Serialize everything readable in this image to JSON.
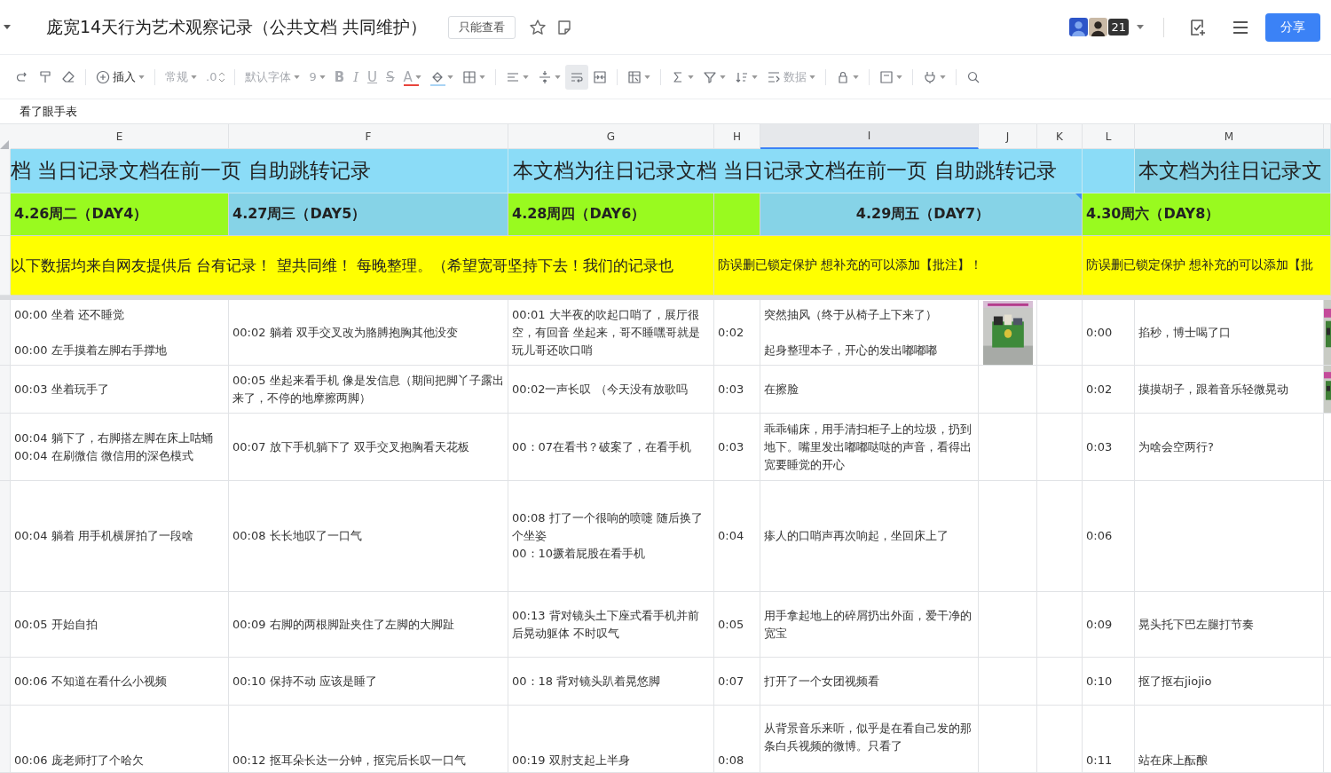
{
  "document": {
    "title": "庞宽14天行为艺术观察记录（公共文档 共同维护）",
    "permission_badge": "只能查看",
    "avatar_count": "21",
    "share_button": "分享"
  },
  "toolbar": {
    "groups": [
      [
        {
          "kind": "redo",
          "active": false
        },
        {
          "kind": "painter",
          "active": false
        },
        {
          "kind": "eraser",
          "active": false
        }
      ],
      [
        {
          "kind": "insert",
          "label": "插入",
          "caret": true,
          "active": false
        }
      ],
      [
        {
          "kind": "format",
          "label": "常规",
          "caret": true,
          "active": false
        },
        {
          "kind": "decimal",
          "label": ".0",
          "active": false
        }
      ],
      [
        {
          "kind": "font",
          "label": "默认字体",
          "caret": true,
          "active": false
        },
        {
          "kind": "size",
          "label": "9",
          "caret": true,
          "active": false
        },
        {
          "kind": "bold",
          "label": "B",
          "active": false
        },
        {
          "kind": "italic",
          "label": "I",
          "active": false
        },
        {
          "kind": "underline",
          "label": "U",
          "active": false
        },
        {
          "kind": "strike",
          "label": "S",
          "active": false
        },
        {
          "kind": "fontcolor",
          "label": "A",
          "caret": true,
          "color": "#e8453c",
          "active": false
        },
        {
          "kind": "fill",
          "caret": true,
          "color": "#a9d4f5",
          "active": false
        },
        {
          "kind": "border",
          "caret": true,
          "active": false
        }
      ],
      [
        {
          "kind": "align",
          "caret": true,
          "active": false
        },
        {
          "kind": "valign",
          "caret": true,
          "active": false
        },
        {
          "kind": "wrap",
          "active": true
        },
        {
          "kind": "merge",
          "active": false
        }
      ],
      [
        {
          "kind": "condfmt",
          "caret": true,
          "active": false
        }
      ],
      [
        {
          "kind": "sum",
          "caret": true,
          "active": false
        },
        {
          "kind": "filter",
          "caret": true,
          "active": false
        },
        {
          "kind": "sort",
          "caret": true,
          "active": false
        },
        {
          "kind": "data",
          "label": "数据",
          "caret": true,
          "active": false
        }
      ],
      [
        {
          "kind": "lock",
          "caret": true,
          "active": false
        }
      ],
      [
        {
          "kind": "frame",
          "caret": true,
          "active": false
        }
      ],
      [
        {
          "kind": "plug",
          "caret": true,
          "active": false
        }
      ],
      [
        {
          "kind": "search",
          "active": false
        }
      ]
    ]
  },
  "formula_bar": {
    "value": "看了眼手表"
  },
  "columns": [
    {
      "label": "E",
      "selected": false
    },
    {
      "label": "F",
      "selected": false
    },
    {
      "label": "G",
      "selected": false
    },
    {
      "label": "H",
      "selected": false
    },
    {
      "label": "I",
      "selected": true
    },
    {
      "label": "J",
      "selected": false
    },
    {
      "label": "K",
      "selected": false
    },
    {
      "label": "L",
      "selected": false
    },
    {
      "label": "M",
      "selected": false
    }
  ],
  "banner_row": [
    "档 当日记录文档在前一页 自助跳转记录",
    "本文档为往日记录文档 当日记录文档在前一页 自助跳转记录",
    "本文档为往日记录文"
  ],
  "day_row": [
    {
      "text": "4.26周二（DAY4）",
      "color": "#99fa1f",
      "has_comment": false
    },
    {
      "text": "4.27周三（DAY5）",
      "color": "#86d3e7",
      "has_comment": false
    },
    {
      "text": "4.28周四（DAY6）",
      "color": "#99fa1f",
      "has_comment": false
    },
    {
      "color": "#99fa1f",
      "has_comment": false
    },
    {
      "text": "4.29周五（DAY7）",
      "color": "#86d3e7",
      "has_comment": true
    },
    {
      "text": "4.30周六（DAY8）",
      "color": "#99fa1f",
      "has_comment": false
    }
  ],
  "notice_row": [
    "以下数据均来自网友提供后 台有记录！ 望共同维！ 每晚整理。（希望宽哥坚持下去！我们的记录也",
    "防误删已锁定保护 想补充的可以添加【批注】！",
    "防误删已锁定保护 想补充的可以添加【批"
  ],
  "rows": [
    {
      "cells": [
        [
          "00:00 坐着 还不睡觉",
          "00:00 左手摸着左脚右手撑地"
        ],
        "00:02 躺着 双手交叉改为胳膊抱胸其他没变",
        "00:01 大半夜的吹起口哨了，展厅很空，有回音 坐起来，哥不睡嘿哥就是玩儿哥还吹口哨",
        "0:02",
        [
          "突然抽风（终于从椅子上下来了）",
          "起身整理本子，开心的发出嘟嘟嘟"
        ],
        "0:00",
        "掐秒，博士喝了口"
      ],
      "picture_in_j": true,
      "picture_at_edge": true
    },
    {
      "cells": [
        "00:03 坐着玩手了",
        "00:05 坐起来看手机 像是发信息（期间把脚丫子露出来了，不停的地摩擦两脚）",
        "00:02一声长叹 （今天没有放歌吗",
        "0:03",
        "在擦脸",
        "0:02",
        "摸摸胡子，跟着音乐轻微晃动"
      ],
      "picture_in_j": false,
      "picture_at_edge": true
    },
    {
      "cells": [
        "00:04 躺下了，右脚搭左脚在床上咕蛹\n00:04 在刷微信 微信用的深色模式",
        "00:07 放下手机躺下了 双手交叉抱胸看天花板",
        "00：07在看书？破案了，在看手机",
        "0:03",
        "乖乖铺床，用手清扫柜子上的垃圾，扔到地下。嘴里发出嘟嘟哒哒的声音，看得出宽要睡觉的开心",
        "0:03",
        "为啥会空两行?"
      ],
      "picture_in_j": false,
      "picture_at_edge": false
    },
    {
      "cells": [
        "00:04 躺着 用手机横屏拍了一段啥",
        "00:08 长长地叹了一口气",
        "00:08 打了一个很响的喷嚏 随后换了个坐姿\n00：10撅着屁股在看手机",
        "0:04",
        "瘆人的口哨声再次响起，坐回床上了",
        "0:06",
        null
      ],
      "picture_in_j": false,
      "picture_at_edge": false
    },
    {
      "cells": [
        "00:05 开始自拍",
        "00:09 右脚的两根脚趾夹住了左脚的大脚趾",
        "00:13 背对镜头土下座式看手机并前后晃动躯体 不时叹气",
        "0:05",
        "用手拿起地上的碎屑扔出外面，爱干净的宽宝",
        "0:09",
        "晃头托下巴左腿打节奏"
      ],
      "picture_in_j": false,
      "picture_at_edge": false
    },
    {
      "cells": [
        "00:06 不知道在看什么小视频",
        "00:10 保持不动 应该是睡了",
        "00：18 背对镜头趴着晃悠脚",
        "0:07",
        "打开了一个女团视频看",
        "0:10",
        "抠了抠右jiojio"
      ],
      "picture_in_j": false,
      "picture_at_edge": false
    },
    {
      "cells": [
        "00:06 庞老师打了个哈欠",
        "00:12 抠耳朵长达一分钟，抠完后长叹一口气",
        "00:19 双肘支起上半身",
        "0:08",
        "从背景音乐来听，似乎是在看自己发的那条白兵视频的微博。只看了",
        "0:11",
        "站在床上酝酿"
      ],
      "picture_in_j": false,
      "picture_at_edge": false
    }
  ]
}
